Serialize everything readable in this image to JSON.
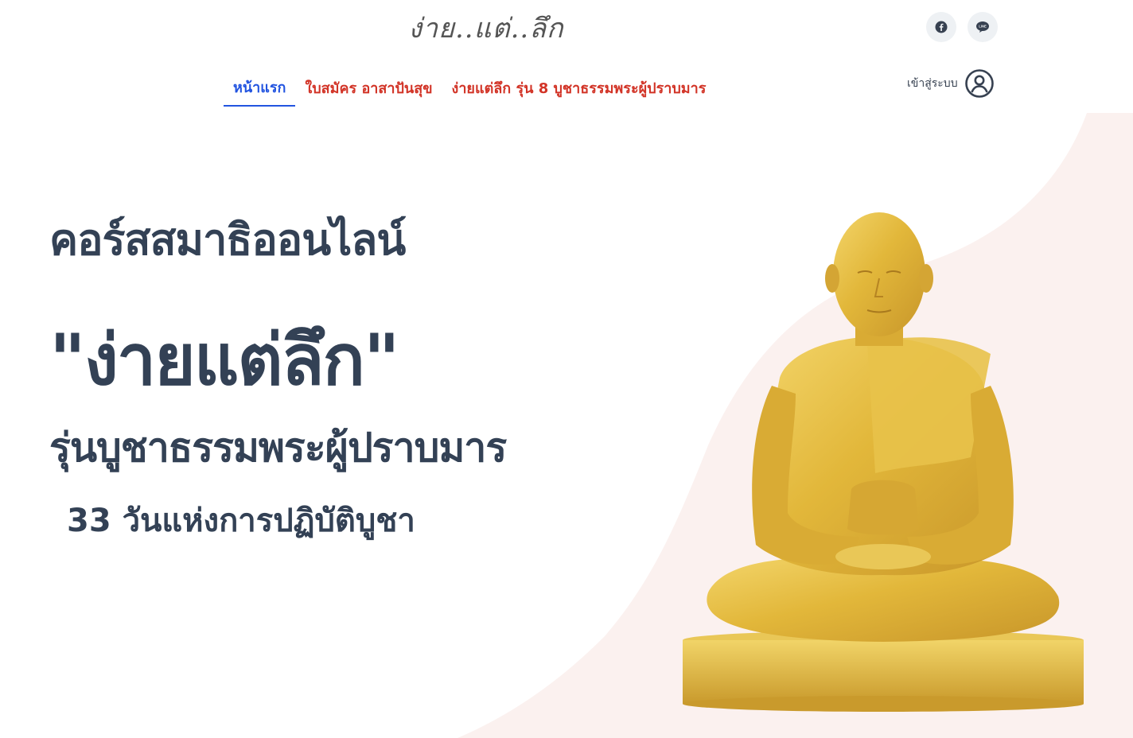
{
  "header": {
    "logo_text": "ง่าย..แต่..ลึก",
    "social": [
      {
        "name": "facebook",
        "icon": "facebook-icon"
      },
      {
        "name": "line",
        "icon": "line-icon",
        "label": "LINE"
      }
    ],
    "nav": [
      {
        "label": "หน้าแรก",
        "active": true
      },
      {
        "label": "ใบสมัคร อาสาปันสุข",
        "active": false
      },
      {
        "label": "ง่ายแต่ลึก รุ่น 8 บูชาธรรมพระผู้ปราบมาร",
        "active": false
      }
    ],
    "login_label": "เข้าสู่ระบบ",
    "login_icon": "user-circle-icon"
  },
  "hero": {
    "course_title": "คอร์สสมาธิออนไลน์",
    "main_title": "\"ง่ายแต่ลึก\"",
    "subtitle": "รุ่นบูชาธรรมพระผู้ปราบมาร",
    "days": "33 วันแห่งการปฏิบัติบูชา",
    "image": "golden-monk-statue"
  },
  "colors": {
    "active_nav": "#2254e0",
    "nav_red": "#d23427",
    "heading": "#334155",
    "bg_shape": "#fbf1ef",
    "gold": "#e0b93a"
  }
}
